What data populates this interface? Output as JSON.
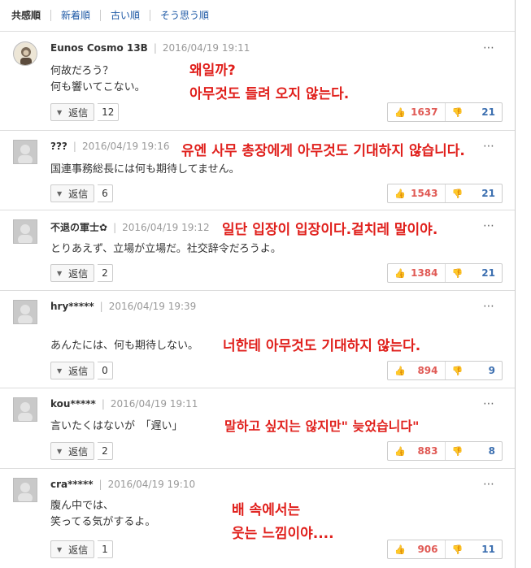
{
  "sort_tabs": [
    "共感順",
    "新着順",
    "古い順",
    "そう思う順"
  ],
  "more_icon": "⋯",
  "reply_label": "返信",
  "comments": [
    {
      "user": "Eunos Cosmo 13B",
      "date": "2016/04/19 19:11",
      "text": "何故だろう？\n何も響いてこない。",
      "replies": "12",
      "good": "1637",
      "bad": "21",
      "translation": "왜일까?\n아무것도 들려 오지 않는다."
    },
    {
      "user": "???",
      "date": "2016/04/19 19:16",
      "text": "国連事務総長には何も期待してません。",
      "replies": "6",
      "good": "1543",
      "bad": "21",
      "translation": "유엔 사무 총장에게 아무것도 기대하지 않습니다."
    },
    {
      "user": "不退の軍士✿",
      "date": "2016/04/19 19:12",
      "text": "とりあえず、立場が立場だ。社交辞令だろうよ。",
      "replies": "2",
      "good": "1384",
      "bad": "21",
      "translation": "일단 입장이 입장이다.겉치레 말이야."
    },
    {
      "user": "hry*****",
      "date": "2016/04/19 19:39",
      "text": "あんたには、何も期待しない。",
      "replies": "0",
      "good": "894",
      "bad": "9",
      "translation": "너한테 아무것도 기대하지 않는다."
    },
    {
      "user": "kou*****",
      "date": "2016/04/19 19:11",
      "text": "言いたくはないが　「遅い」",
      "replies": "2",
      "good": "883",
      "bad": "8",
      "translation": "말하고 싶지는 않지만\" 늦었습니다\""
    },
    {
      "user": "cra*****",
      "date": "2016/04/19 19:10",
      "text": "腹ん中では、\n笑ってる気がするよ。",
      "replies": "1",
      "good": "906",
      "bad": "11",
      "translation": "배 속에서는\n웃는 느낌이야...."
    }
  ]
}
